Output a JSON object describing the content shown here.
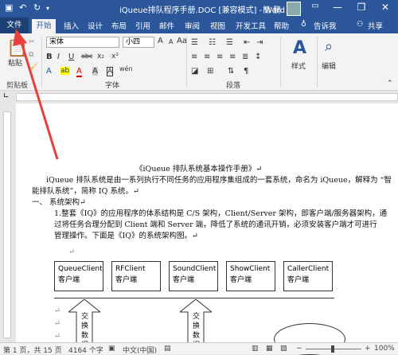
{
  "window": {
    "title": "iQueue排队程序手册.DOC [兼容模式] - Word",
    "user": "熊 鹏",
    "minimize": "—",
    "restore": "❐",
    "close": "✕"
  },
  "tabs": [
    "文件",
    "开始",
    "插入",
    "设计",
    "布局",
    "引用",
    "邮件",
    "审阅",
    "视图",
    "开发工具",
    "帮助",
    "告诉我"
  ],
  "share": "共享",
  "ribbon": {
    "paste": "粘贴",
    "clipboard": "剪贴板",
    "font_name": "宋体",
    "font_size": "小四",
    "font_group": "字体",
    "para_group": "段落",
    "styles": "样式",
    "editing": "编辑",
    "bold": "B",
    "italic": "I",
    "underline": "U",
    "strike": "abc",
    "sub": "x₂",
    "sup": "x²",
    "grow": "A",
    "wen": "wén",
    "a_big": "A"
  },
  "doc": {
    "title": "《iQueue 排队系统基本操作手册》↵",
    "para1a": "iQueue 排队系统是由一系列执行不同任务的应用程序集组成的一套系统，命名为 iQueue，解释为 “智",
    "para1b": "能排队系统”，简称 IQ 系统。↵",
    "heading": "一、  系统架构↵",
    "p2a": "1.整套《IQ》的应用程序的体系结构是 C/S 架构，Client/Server 架构，即客户端/服务器架构，通",
    "p2b": "过将任务合理分配到 Client 端和 Server 端，降低了系统的通讯开销，必须安装客户端才可进行",
    "p2c": "管理操作。下面是《IQ》的系统架构图。↵",
    "boxes": [
      {
        "name": "QueueClient",
        "sub": "客户端"
      },
      {
        "name": "RFClient",
        "sub": "客户端"
      },
      {
        "name": "SoundClient",
        "sub": "客户端"
      },
      {
        "name": "ShowClient",
        "sub": "客户端"
      },
      {
        "name": "CallerClient",
        "sub": "客户端"
      }
    ],
    "arrow1": "交换数据",
    "arrow2": "交换数据",
    "mark": "↵"
  },
  "status": {
    "page": "第 1 页，共 15 页",
    "words": "4164 个字",
    "lang": "中文(中国)",
    "zoom": "100%",
    "minus": "−",
    "plus": "+"
  },
  "colors": {
    "title_bg": "#2b579a",
    "ribbon_bg": "#f3f3f3",
    "arrow_red": "#e8403a"
  }
}
